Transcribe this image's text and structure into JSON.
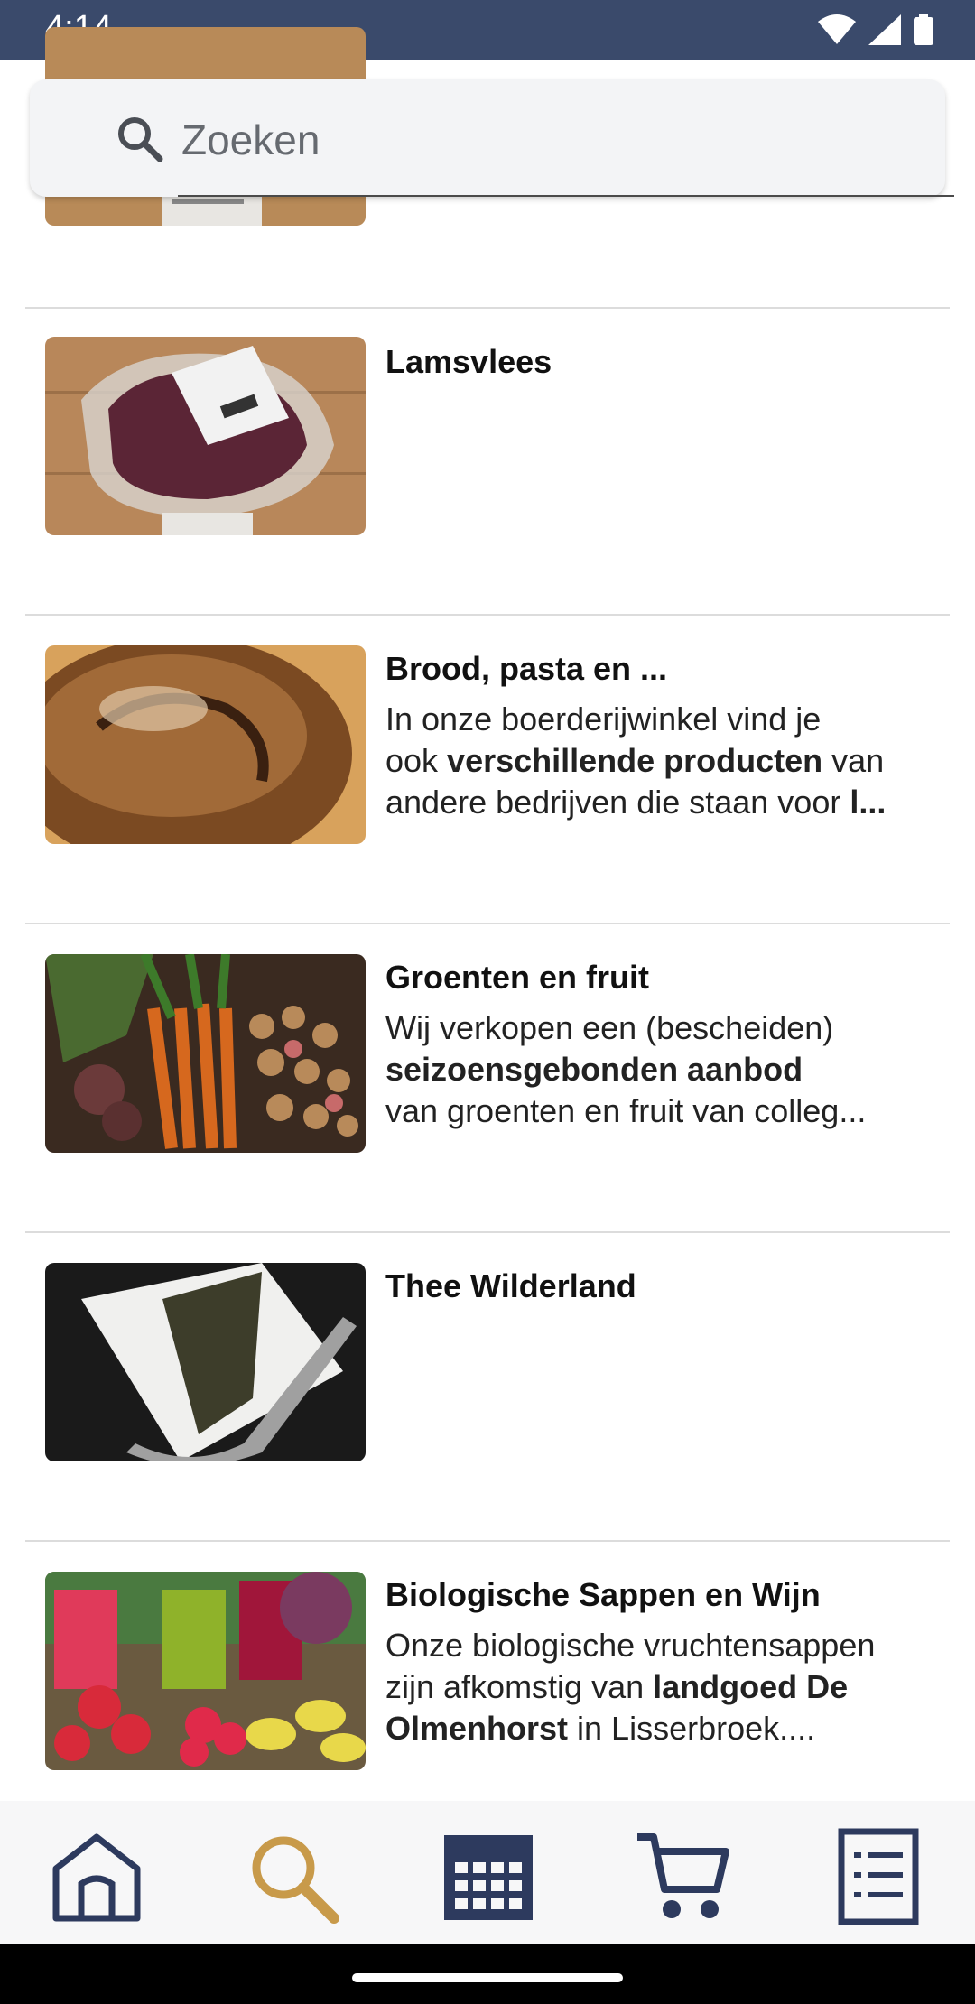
{
  "status_bar": {
    "time": "4:14"
  },
  "search": {
    "placeholder": "Zoeken"
  },
  "items": [
    {
      "title": "",
      "desc": []
    },
    {
      "title": "Lamsvlees",
      "desc": []
    },
    {
      "title": "Brood, pasta en ...",
      "desc": [
        "In onze boerderijwinkel vind je",
        "ook ",
        "verschillende producten",
        " van",
        "andere bedrijven die staan voor ",
        "l..."
      ]
    },
    {
      "title": "Groenten en fruit",
      "desc": [
        "Wij verkopen een (bescheiden)",
        "seizoensgebonden aanbod",
        "van groenten en fruit van colleg..."
      ]
    },
    {
      "title": "Thee Wilderland",
      "desc": []
    },
    {
      "title": "Biologische Sappen en Wijn",
      "desc": [
        "Onze biologische vruchtensappen",
        "zijn afkomstig van ",
        "landgoed De",
        "Olmenhorst",
        " in Lisserbroek...."
      ]
    }
  ],
  "nav": [
    {
      "icon": "home-icon"
    },
    {
      "icon": "search-icon",
      "active": true
    },
    {
      "icon": "calendar-icon"
    },
    {
      "icon": "cart-icon"
    },
    {
      "icon": "list-icon"
    }
  ],
  "colors": {
    "primary": "#2d3a5e",
    "accent": "#c89a4a",
    "status_bar": "#3a4a6b"
  }
}
